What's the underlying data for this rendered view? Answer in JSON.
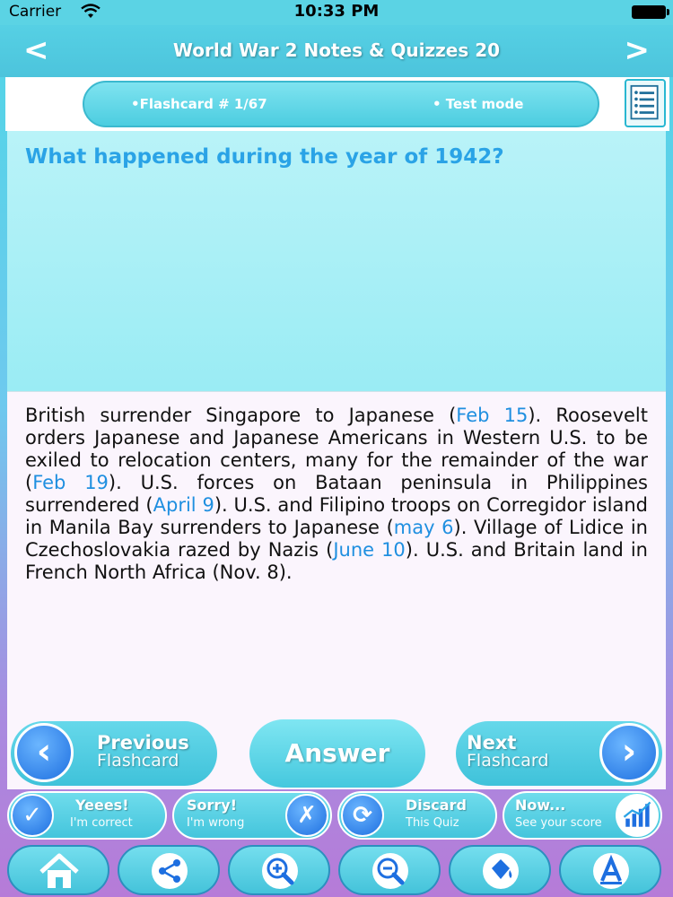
{
  "status": {
    "carrier": "Carrier",
    "time": "10:33 PM"
  },
  "header": {
    "title": "World War 2 Notes & Quizzes 20",
    "prev_arrow": "<",
    "next_arrow": ">"
  },
  "info": {
    "counter": "•Flashcard #  1/67",
    "mode": "• Test mode"
  },
  "question": "What happened during the year of 1942?",
  "answer": {
    "parts": [
      {
        "text": "British surrender Singapore to Japanese (",
        "hl": false
      },
      {
        "text": "Feb 15",
        "hl": true
      },
      {
        "text": "). Roosevelt orders Japanese and Japanese Americans in Western U.S. to be exiled to relocation centers, many for the remainder of the war (",
        "hl": false
      },
      {
        "text": "Feb 19",
        "hl": true
      },
      {
        "text": "). U.S. forces on Bataan peninsula in Philippines surrendered (",
        "hl": false
      },
      {
        "text": "April 9",
        "hl": true
      },
      {
        "text": "). U.S. and Filipino troops on Corregidor island in Manila Bay surrenders to Japanese (",
        "hl": false
      },
      {
        "text": "may 6",
        "hl": true
      },
      {
        "text": "). Village of Lidice in Czechoslovakia razed by Nazis (",
        "hl": false
      },
      {
        "text": "June 10",
        "hl": true
      },
      {
        "text": "). U.S. and Britain land in French North Africa (Nov. 8).",
        "hl": false
      }
    ]
  },
  "nav": {
    "previous_title": "Previous",
    "previous_sub": "Flashcard",
    "answer": "Answer",
    "next_title": "Next",
    "next_sub": "Flashcard"
  },
  "actions": {
    "correct_title": "Yeees!",
    "correct_sub": "I'm correct",
    "wrong_title": "Sorry!",
    "wrong_sub": "I'm wrong",
    "discard_title": "Discard",
    "discard_sub": "This Quiz",
    "score_title": "Now...",
    "score_sub": "See your score"
  },
  "icons": [
    "wifi-icon",
    "battery-icon",
    "notes-icon",
    "home-icon",
    "share-icon",
    "zoom-in-icon",
    "zoom-out-icon",
    "paint-bucket-icon",
    "font-icon"
  ],
  "colors": {
    "accent": "#45c8de",
    "question": "#2aa3e6",
    "highlight": "#1f8fe0"
  }
}
